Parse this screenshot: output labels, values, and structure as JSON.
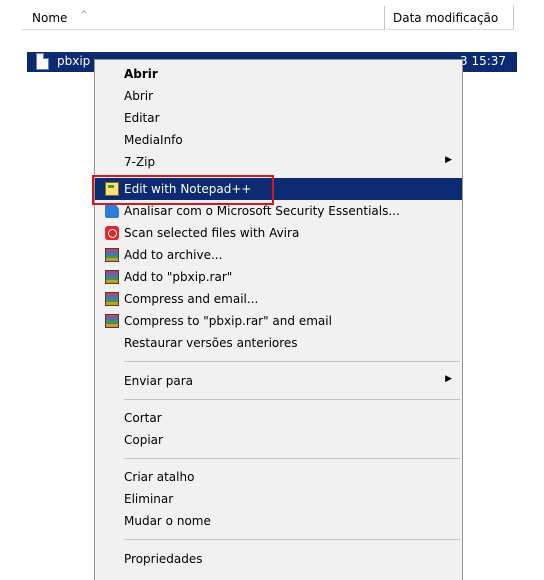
{
  "columns": {
    "name_label": "Nome",
    "sort_indicator": "^",
    "date_label": "Data modificação"
  },
  "file": {
    "name": "pbxip",
    "modified": "3 15:37"
  },
  "menu": {
    "open_bold": "Abrir",
    "open": "Abrir",
    "edit": "Editar",
    "mediainfo": "MediaInfo",
    "sevenzip": "7-Zip",
    "notepad": "Edit with Notepad++",
    "mse": "Analisar com o Microsoft Security Essentials...",
    "avira": "Scan selected files with Avira",
    "add_archive": "Add to archive...",
    "add_rar": "Add to \"pbxip.rar\"",
    "compress_email": "Compress and email...",
    "compress_rar_email": "Compress to \"pbxip.rar\" and email",
    "restore": "Restaurar versões anteriores",
    "send_to": "Enviar para",
    "cut": "Cortar",
    "copy": "Copiar",
    "shortcut": "Criar atalho",
    "delete": "Eliminar",
    "rename": "Mudar o nome",
    "properties": "Propriedades"
  },
  "colors": {
    "selection": "#0b2a72",
    "menu_bg": "#f1f1f1",
    "annotation_red": "#d0181e"
  }
}
